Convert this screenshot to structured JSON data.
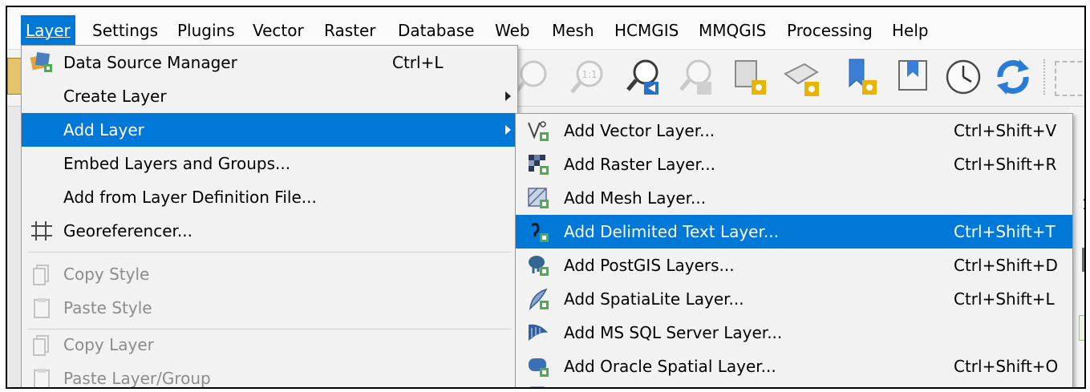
{
  "menubar": {
    "items": [
      {
        "label": "Layer",
        "underline": "L"
      },
      {
        "label": "Settings"
      },
      {
        "label": "Plugins"
      },
      {
        "label": "Vector"
      },
      {
        "label": "Raster"
      },
      {
        "label": "Database"
      },
      {
        "label": "Web"
      },
      {
        "label": "Mesh"
      },
      {
        "label": "HCMGIS"
      },
      {
        "label": "MMQGIS"
      },
      {
        "label": "Processing"
      },
      {
        "label": "Help"
      }
    ]
  },
  "layer_menu": {
    "items": [
      {
        "label": "Data Source Manager",
        "shortcut": "Ctrl+L",
        "icon": "data-source-manager-icon"
      },
      {
        "label": "Create Layer",
        "submenu": true
      },
      {
        "label": "Add Layer",
        "submenu": true,
        "highlighted": true
      },
      {
        "label": "Embed Layers and Groups..."
      },
      {
        "label": "Add from Layer Definition File..."
      },
      {
        "label": "Georeferencer...",
        "icon": "georeferencer-icon"
      },
      {
        "label": "Copy Style",
        "disabled": true,
        "icon": "copy-style-icon"
      },
      {
        "label": "Paste Style",
        "disabled": true,
        "icon": "paste-style-icon"
      },
      {
        "label": "Copy Layer",
        "disabled": true,
        "icon": "copy-layer-icon"
      },
      {
        "label": "Paste Layer/Group",
        "disabled": true,
        "icon": "paste-layer-icon"
      }
    ]
  },
  "add_layer_submenu": {
    "items": [
      {
        "label": "Add Vector Layer...",
        "shortcut": "Ctrl+Shift+V",
        "icon": "vector-layer-icon"
      },
      {
        "label": "Add Raster Layer...",
        "shortcut": "Ctrl+Shift+R",
        "icon": "raster-layer-icon"
      },
      {
        "label": "Add Mesh Layer...",
        "shortcut": "",
        "icon": "mesh-layer-icon"
      },
      {
        "label": "Add Delimited Text Layer...",
        "shortcut": "Ctrl+Shift+T",
        "icon": "delimited-text-icon",
        "highlighted": true
      },
      {
        "label": "Add PostGIS Layers...",
        "shortcut": "Ctrl+Shift+D",
        "icon": "postgis-icon"
      },
      {
        "label": "Add SpatiaLite Layer...",
        "shortcut": "Ctrl+Shift+L",
        "icon": "spatialite-icon"
      },
      {
        "label": "Add MS SQL Server Layer...",
        "shortcut": "",
        "icon": "mssql-icon"
      },
      {
        "label": "Add Oracle Spatial Layer...",
        "shortcut": "Ctrl+Shift+O",
        "icon": "oracle-icon"
      }
    ]
  },
  "colors": {
    "highlight": "#0078d7",
    "disabled_text": "#8c8c8c"
  }
}
